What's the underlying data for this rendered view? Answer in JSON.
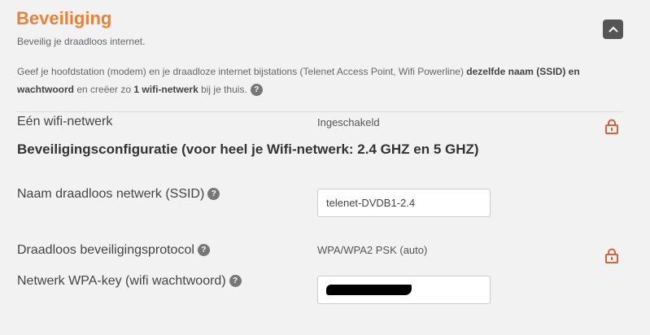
{
  "header": {
    "title": "Beveiliging",
    "subtitle": "Beveilig je draadloos internet."
  },
  "intro": {
    "text_1": "Geef je hoofdstation (modem) en je draadloze internet bijstations (Telenet Access Point, Wifi Powerline) ",
    "bold_1": "dezelfde naam (SSID) en wachtwoord",
    "text_2": " en creëer zo ",
    "bold_2": "1 wifi-netwerk",
    "text_3": " bij je thuis."
  },
  "one_network": {
    "label": "Eén wifi-netwerk",
    "value": "Ingeschakeld"
  },
  "security_config": {
    "heading": "Beveiligingsconfiguratie (voor heel je Wifi-netwerk: 2.4 GHZ en 5 GHZ)"
  },
  "ssid": {
    "label": "Naam draadloos netwerk (SSID)",
    "value": "telenet-DVDB1-2.4"
  },
  "protocol": {
    "label": "Draadloos beveiligingsprotocol",
    "value": "WPA/WPA2 PSK (auto)"
  },
  "wpa_key": {
    "label": "Netwerk WPA-key (wifi wachtwoord)"
  },
  "icons": {
    "help": "?",
    "collapse": "chevron-up-icon",
    "lock": "lock-icon"
  },
  "colors": {
    "accent": "#e8823a",
    "lock": "#d9623b"
  }
}
